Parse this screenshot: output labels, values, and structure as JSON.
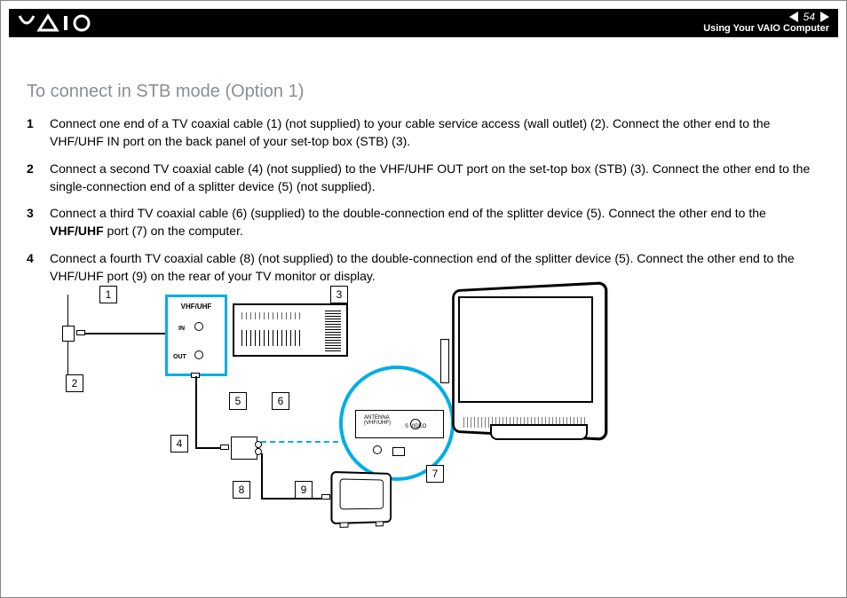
{
  "header": {
    "page_number": "54",
    "section": "Using Your VAIO Computer"
  },
  "heading": "To connect in STB mode (Option 1)",
  "steps": [
    "Connect one end of a TV coaxial cable (1) (not supplied) to your cable service access (wall outlet) (2). Connect the other end to the VHF/UHF IN port on the back panel of your set-top box (STB) (3).",
    "Connect a second TV coaxial cable (4) (not supplied) to the VHF/UHF OUT port on the set-top box (STB) (3). Connect the other end to the single-connection end of a splitter device (5) (not supplied).",
    "Connect a third TV coaxial cable (6) (supplied) to the double-connection end of the splitter device (5). Connect the other end to the VHF/UHF port (7) on the computer.",
    "Connect a fourth TV coaxial cable (8) (not supplied) to the double-connection end of the splitter device (5). Connect the other end to the VHF/UHF port (9) on the rear of your TV monitor or display."
  ],
  "step3_bold": "VHF/UHF",
  "diagram": {
    "callouts": {
      "1": "1",
      "2": "2",
      "3": "3",
      "4": "4",
      "5": "5",
      "6": "6",
      "7": "7",
      "8": "8",
      "9": "9"
    },
    "stb_box": {
      "title": "VHF/UHF",
      "in": "IN",
      "out": "OUT"
    },
    "magnifier": {
      "antenna": "ANTENNA\n(VHF/UHF)",
      "svideo": "S VIDEO"
    }
  }
}
